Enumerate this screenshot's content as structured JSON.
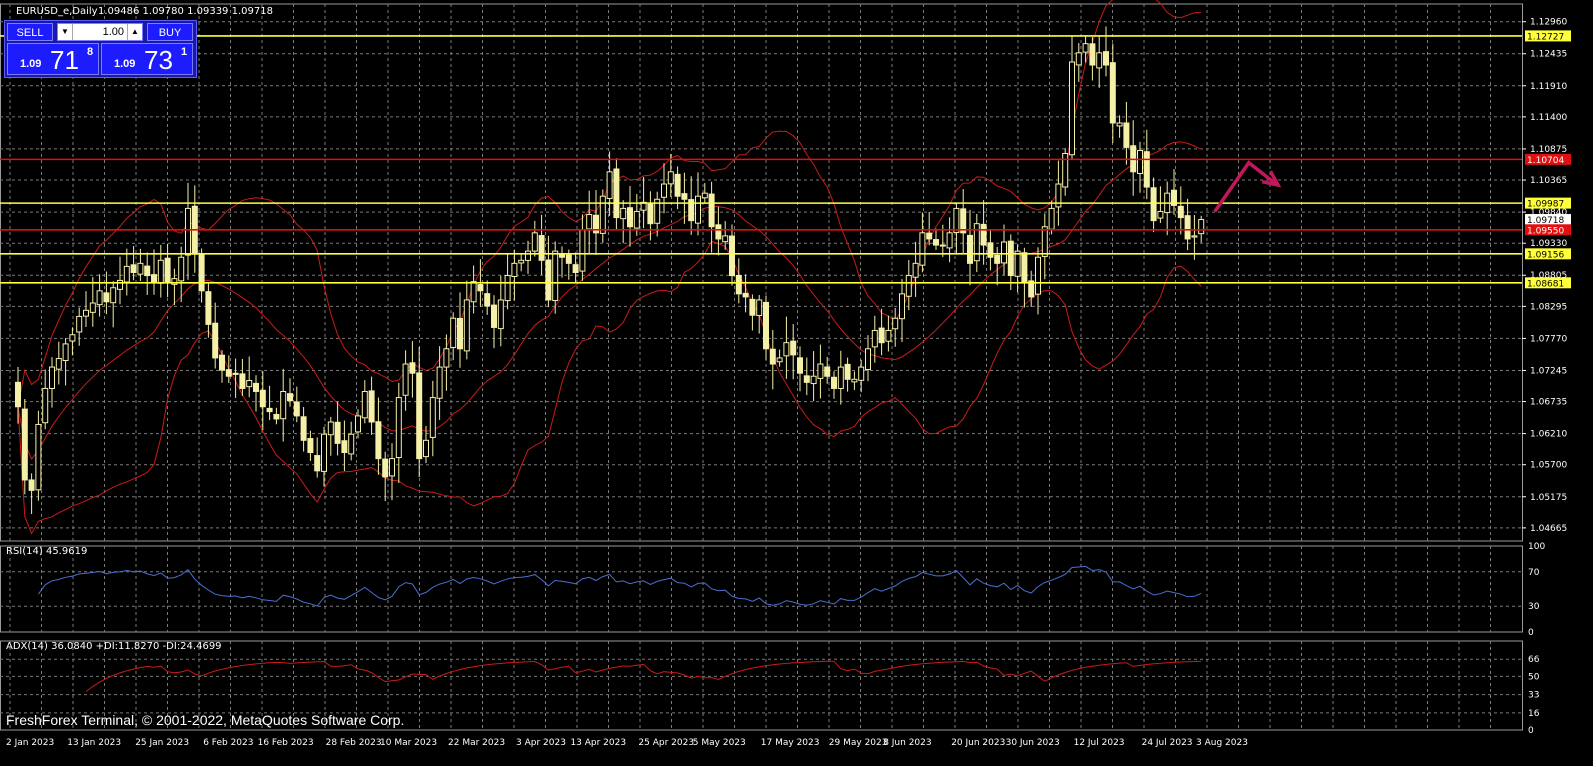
{
  "header": {
    "title": "EURUSD_e,Daily",
    "ohlc": "1.09486 1.09780 1.09339 1.09718"
  },
  "trade_panel": {
    "sell_label": "SELL",
    "buy_label": "BUY",
    "lot": "1.00",
    "sell_price": {
      "prefix": "1.09",
      "big": "71",
      "sup": "8"
    },
    "buy_price": {
      "prefix": "1.09",
      "big": "73",
      "sup": "1"
    }
  },
  "watermark": "FreshForex Terminal, © 2001-2022, MetaQuotes Software Corp.",
  "colors": {
    "background": "#000000",
    "grid": "#7a7a7a",
    "candle_up_fill": "#000000",
    "candle_down_fill": "#f5f0a8",
    "candle_border": "#f5f0a8",
    "bollinger": "#cc1a1a",
    "yellow_level": "#ffff3a",
    "red_level": "#e01010",
    "rsi_line": "#4a6fd0",
    "adx_line": "#cc1a1a",
    "arrow": "#c2185b",
    "axis_text": "#ffffff"
  },
  "chart_data": [
    {
      "type": "candlestick",
      "symbol": "EURUSD_e",
      "timeframe": "Daily",
      "title": "EURUSD_e,Daily",
      "ohlc_last": {
        "open": 1.09486,
        "high": 1.0978,
        "low": 1.09339,
        "close": 1.09718
      },
      "ylim": [
        1.0445,
        1.1325
      ],
      "y_ticks": [
        "1.12960",
        "1.12435",
        "1.11910",
        "1.11400",
        "1.10875",
        "1.10365",
        "1.09840",
        "1.09330",
        "1.08805",
        "1.08295",
        "1.07770",
        "1.07245",
        "1.06735",
        "1.06210",
        "1.05700",
        "1.05175",
        "1.04665"
      ],
      "x_labels": [
        "2 Jan 2023",
        "13 Jan 2023",
        "25 Jan 2023",
        "6 Feb 2023",
        "16 Feb 2023",
        "28 Feb 2023",
        "10 Mar 2023",
        "22 Mar 2023",
        "3 Apr 2023",
        "13 Apr 2023",
        "25 Apr 2023",
        "5 May 2023",
        "17 May 2023",
        "29 May 2023",
        "8 Jun 2023",
        "20 Jun 2023",
        "30 Jun 2023",
        "12 Jul 2023",
        "24 Jul 2023",
        "3 Aug 2023"
      ],
      "x_label_days": [
        0,
        9,
        19,
        29,
        37,
        47,
        55,
        65,
        75,
        83,
        93,
        101,
        111,
        121,
        129,
        139,
        147,
        157,
        167,
        175
      ],
      "n_days": 179,
      "closes": [
        1.0665,
        1.0545,
        1.0528,
        1.0636,
        1.0695,
        1.073,
        1.0744,
        1.0768,
        1.0783,
        1.0813,
        1.0823,
        1.0835,
        1.0855,
        1.0837,
        1.086,
        1.0872,
        1.0895,
        1.0885,
        1.09,
        1.088,
        1.0868,
        1.0905,
        1.0868,
        1.0875,
        1.091,
        1.099,
        1.0915,
        1.0855,
        1.08,
        1.0745,
        1.0725,
        1.0715,
        1.0718,
        1.0695,
        1.0708,
        1.069,
        1.0665,
        1.0657,
        1.0645,
        1.069,
        1.0675,
        1.065,
        1.061,
        1.059,
        1.056,
        1.062,
        1.064,
        1.0605,
        1.059,
        1.062,
        1.065,
        1.069,
        1.064,
        1.058,
        1.055,
        1.058,
        1.068,
        1.0735,
        1.072,
        1.058,
        1.061,
        1.068,
        1.073,
        1.076,
        1.081,
        1.076,
        1.084,
        1.087,
        1.0855,
        1.083,
        1.0795,
        1.084,
        1.088,
        1.09,
        1.0905,
        1.092,
        1.095,
        1.0905,
        1.084,
        1.092,
        1.091,
        1.09,
        1.0885,
        1.0955,
        1.098,
        1.095,
        1.101,
        1.105,
        1.0975,
        1.099,
        1.096,
        1.0985,
        1.1,
        1.0965,
        1.1005,
        1.103,
        1.105,
        1.101,
        1.1005,
        1.097,
        1.101,
        1.1015,
        1.096,
        1.094,
        1.0945,
        1.088,
        1.085,
        1.0845,
        1.0815,
        1.084,
        1.076,
        1.0735,
        1.0745,
        1.077,
        1.075,
        1.072,
        1.0705,
        1.0715,
        1.0735,
        1.0715,
        1.0695,
        1.073,
        1.071,
        1.071,
        1.073,
        1.076,
        1.079,
        1.077,
        1.079,
        1.081,
        1.085,
        1.088,
        1.09,
        1.095,
        1.094,
        1.093,
        1.093,
        1.095,
        1.099,
        1.095,
        1.09,
        1.0965,
        1.093,
        1.091,
        1.09,
        1.0935,
        1.088,
        1.092,
        1.087,
        1.0845,
        1.091,
        1.096,
        1.099,
        1.103,
        1.108,
        1.123,
        1.1245,
        1.126,
        1.1225,
        1.1245,
        1.1225,
        1.113,
        1.113,
        1.109,
        1.105,
        1.1085,
        1.1025,
        1.097,
        1.0985,
        1.1015,
        1.0995,
        1.0975,
        1.094,
        1.0945,
        1.0972
      ],
      "levels": [
        {
          "label": "1.12727",
          "value": 1.12727,
          "color": "yellow"
        },
        {
          "label": "1.10704",
          "value": 1.10704,
          "color": "red"
        },
        {
          "label": "1.09987",
          "value": 1.09987,
          "color": "yellow"
        },
        {
          "label": "1.09718",
          "value": 1.09718,
          "color": "white"
        },
        {
          "label": "1.09550",
          "value": 1.0955,
          "color": "red"
        },
        {
          "label": "1.09156",
          "value": 1.09156,
          "color": "yellow"
        },
        {
          "label": "1.08681",
          "value": 1.08681,
          "color": "yellow"
        }
      ],
      "bollinger_bands": {
        "period": 20,
        "deviation": 2
      },
      "arrow_path": [
        [
          176,
          1.0985
        ],
        [
          181,
          1.1065
        ],
        [
          185,
          1.103
        ]
      ]
    },
    {
      "type": "line",
      "name": "RSI(14)",
      "label": "RSI(14) 45.9619",
      "value": 45.9619,
      "ylim": [
        0,
        100
      ],
      "y_ticks": [
        "100",
        "70",
        "30",
        "0"
      ]
    },
    {
      "type": "line",
      "name": "ADX(14)",
      "label": "ADX(14) 36.0840 +DI:11.8270 -DI:24.4699",
      "adx": 36.084,
      "plus_di": 11.827,
      "minus_di": 24.4699,
      "ylim": [
        0,
        83
      ],
      "y_ticks": [
        "66",
        "50",
        "33",
        "16",
        "0"
      ]
    }
  ]
}
